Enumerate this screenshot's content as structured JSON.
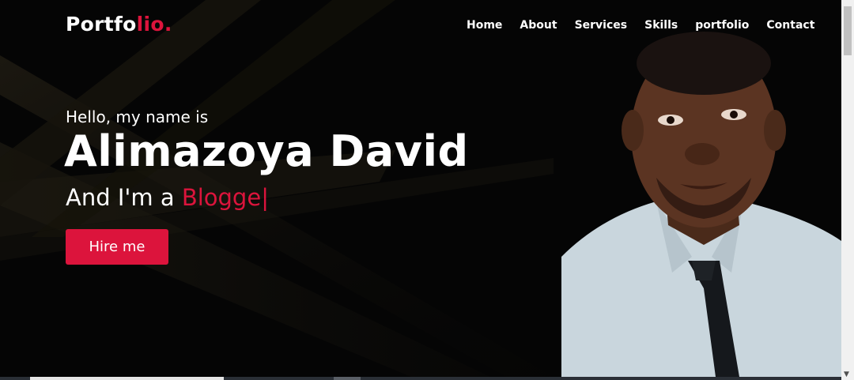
{
  "brand": {
    "name_main": "Portfo",
    "name_accent": "lio."
  },
  "nav": {
    "items": [
      "Home",
      "About",
      "Services",
      "Skills",
      "portfolio",
      "Contact"
    ]
  },
  "hero": {
    "greeting": "Hello, my name is",
    "name": "Alimazoya David",
    "role_prefix": "And I'm a ",
    "role_typed": "Blogge",
    "cursor": "|",
    "cta_label": "Hire me"
  },
  "colors": {
    "accent": "#dc143c",
    "background": "#050505",
    "text": "#ffffff"
  },
  "icons": {
    "scroll_down": "scroll-down-arrow-icon"
  }
}
